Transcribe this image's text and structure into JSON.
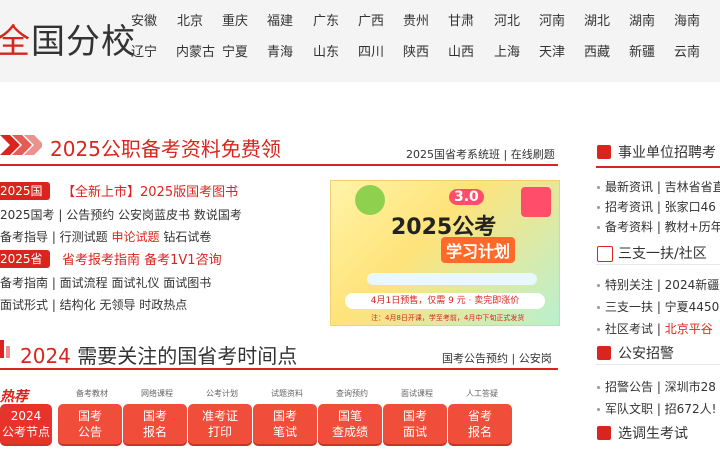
{
  "logo": {
    "red": "全",
    "text": "国分校"
  },
  "provinces_row1": [
    "安徽",
    "北京",
    "重庆",
    "福建",
    "广东",
    "广西",
    "贵州",
    "甘肃",
    "河北",
    "河南",
    "湖北",
    "湖南",
    "海南"
  ],
  "provinces_row2": [
    "辽宁",
    "内蒙古",
    "宁夏",
    "青海",
    "山东",
    "四川",
    "陕西",
    "山西",
    "上海",
    "天津",
    "西藏",
    "新疆",
    "云南"
  ],
  "section1": {
    "title": "2025公职备考资料免费领",
    "links": "2025国省考系统班 | 在线刷题"
  },
  "guokao": {
    "tag": "2025国考",
    "headline": "【全新上市】2025版国考图书",
    "line1": "2025国考 | 公告预约  公安岗蓝皮书  数说国考",
    "line2a": "备考指导 | 行测试题 ",
    "line2b": "申论试题",
    "line2c": "  钻石试卷"
  },
  "shengkao": {
    "tag": "2025省考",
    "headline": "省考报考指南 备考1V1咨询",
    "line1": "备考指南 | 面试流程  面试礼仪  面试图书",
    "line2": "面试形式 | 结构化  无领导  时政热点"
  },
  "banner": {
    "badge": "3.0",
    "title": "2025公考",
    "subtitle": "学习计划",
    "pill": "4月1日预售，仅需 9 元 · 卖完即涨价",
    "foot": "注：4月8日开课，学至考前，4月中下旬正式发货"
  },
  "section2": {
    "title_num": "2024",
    "title_text": "需要关注的国省考时间点",
    "links": "国考公告预约 | 公安岗"
  },
  "hot": {
    "label": "热荐",
    "captions": [
      "备考教材",
      "网络课程",
      "公考计划",
      "试题资料",
      "查询预约",
      "面试课程",
      "人工答疑"
    ],
    "buttons": [
      {
        "l1": "2024",
        "l2": "公考节点"
      },
      {
        "l1": "国考",
        "l2": "公告"
      },
      {
        "l1": "国考",
        "l2": "报名"
      },
      {
        "l1": "准考证",
        "l2": "打印"
      },
      {
        "l1": "国考",
        "l2": "笔试"
      },
      {
        "l1": "国笔",
        "l2": "查成绩"
      },
      {
        "l1": "国考",
        "l2": "面试"
      },
      {
        "l1": "省考",
        "l2": "报名"
      }
    ]
  },
  "right": {
    "h1": "事业单位招聘考",
    "r1": [
      {
        "a": "最新资讯 | 吉林省省直"
      },
      {
        "a": "招考资讯 | 张家口46"
      },
      {
        "a": "备考资料 | 教材+历年"
      }
    ],
    "h2": "三支一扶/社区",
    "r2": [
      {
        "a": "特别关注 | 2024新疆"
      },
      {
        "a": "三支一扶 | 宁夏4450"
      },
      {
        "a": "社区考试 | ",
        "b": "北京平谷"
      }
    ],
    "h3": "公安招警",
    "r3": [
      {
        "a": "招警公告 | 深圳市28"
      },
      {
        "a": "军队文职 | 招672人!"
      }
    ],
    "h4": "选调生考试"
  }
}
